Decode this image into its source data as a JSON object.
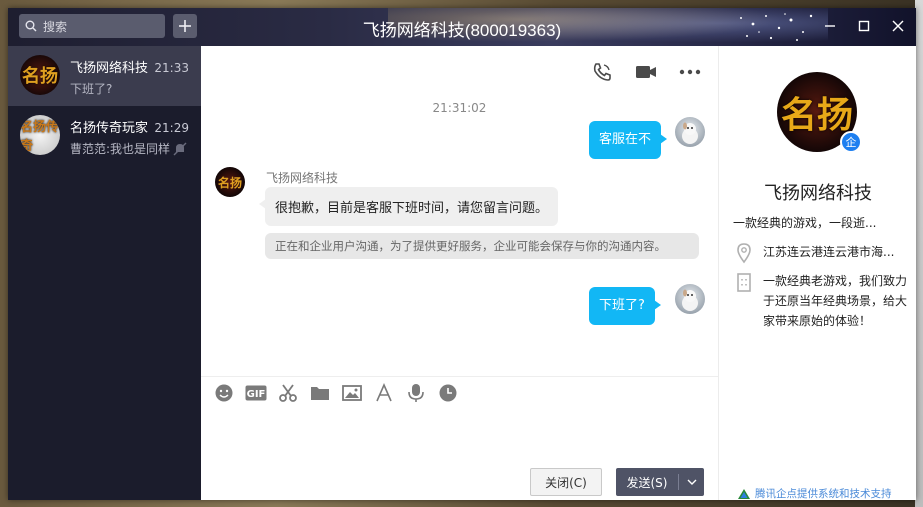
{
  "window": {
    "title": "飞扬网络科技(800019363)"
  },
  "search": {
    "placeholder": "搜索"
  },
  "conversations": [
    {
      "name": "飞扬网络科技",
      "last_message": "下班了?",
      "time": "21:33",
      "avatar_text": "名扬",
      "active": true
    },
    {
      "name": "名扬传奇玩家",
      "last_message": "曹范范:我也是同样",
      "time": "21:29",
      "avatar_text": "名扬传奇",
      "muted": true
    }
  ],
  "chat": {
    "timestamp": "21:31:02",
    "messages": [
      {
        "direction": "out",
        "text": "客服在不"
      },
      {
        "direction": "in",
        "sender": "飞扬网络科技",
        "text": "很抱歉，目前是客服下班时间，请您留言问题。"
      },
      {
        "direction": "system",
        "text": "正在和企业用户沟通，为了提供更好服务，企业可能会保存与你的沟通内容。"
      },
      {
        "direction": "out",
        "text": "下班了?"
      }
    ],
    "toolbar_icons": [
      "emoji-icon",
      "gif-icon",
      "scissors-icon",
      "folder-icon",
      "image-icon",
      "font-icon",
      "microphone-icon",
      "clock-icon"
    ],
    "gif_label": "GIF",
    "close_label": "关闭(C)",
    "send_label": "发送(S)"
  },
  "profile": {
    "name": "飞扬网络科技",
    "signature": "一款经典的游戏，一段逝...",
    "address": "江苏连云港连云港市海...",
    "description": "一款经典老游戏，我们致力于还原当年经典场景，给大家带来原始的体验！",
    "verified_badge": "企",
    "avatar_text": "名扬",
    "footer": "腾讯企点提供系统和技术支持"
  },
  "colors": {
    "accent": "#12b7f5",
    "sidebar": "#1b1c2c",
    "send_button": "#4f5366",
    "verified": "#1e7ff0"
  }
}
